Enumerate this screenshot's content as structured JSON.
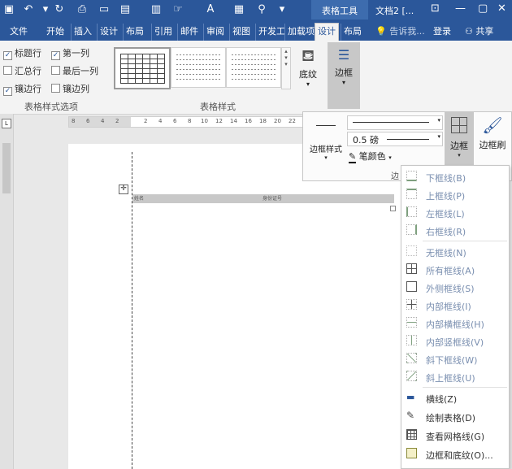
{
  "quick_access": {
    "icons": [
      "save-icon",
      "undo-icon",
      "redo-icon",
      "print-preview-icon",
      "new-doc-icon",
      "paste-icon",
      "format-icon",
      "touch-icon",
      "font-color-icon",
      "layout-icon",
      "search-icon",
      "more-icon"
    ]
  },
  "title": {
    "context": "表格工具",
    "doc": "文档2 [..."
  },
  "tabs": [
    "文件",
    "开始",
    "插入",
    "设计",
    "布局",
    "引用",
    "邮件",
    "审阅",
    "视图",
    "开发工",
    "加载项",
    "设计",
    "布局"
  ],
  "tell_me": "告诉我...",
  "login": "登录",
  "share": "共享",
  "ribbon": {
    "options": {
      "header_row": "标题行",
      "first_col": "第一列",
      "total_row": "汇总行",
      "last_col": "最后一列",
      "banded_rows": "镶边行",
      "banded_cols": "镶边列",
      "group": "表格样式选项"
    },
    "styles_group": "表格样式",
    "shading": "底纹",
    "borders": "边框"
  },
  "ruler": {
    "top": [
      "8",
      "6",
      "4",
      "2",
      "",
      "2",
      "4",
      "6",
      "8",
      "10",
      "12",
      "14",
      "16",
      "18",
      "20",
      "22"
    ]
  },
  "table_row": {
    "left": "姓名",
    "right": "身份证号"
  },
  "border_pane": {
    "style_label": "边框样式",
    "weight": "0.5 磅",
    "pen_color": "笔颜色",
    "borders_btn": "边框",
    "painter_btn": "边框刷",
    "group": "边"
  },
  "menu": [
    {
      "label": "下框线(B)",
      "icon": "border-bottom-icon",
      "dim": true
    },
    {
      "label": "上框线(P)",
      "icon": "border-top-icon",
      "dim": true
    },
    {
      "label": "左框线(L)",
      "icon": "border-left-icon",
      "dim": true
    },
    {
      "label": "右框线(R)",
      "icon": "border-right-icon",
      "dim": true
    },
    {
      "label": "无框线(N)",
      "icon": "border-none-icon",
      "dim": true
    },
    {
      "label": "所有框线(A)",
      "icon": "border-all-icon",
      "dim": true
    },
    {
      "label": "外侧框线(S)",
      "icon": "border-outside-icon",
      "dim": true
    },
    {
      "label": "内部框线(I)",
      "icon": "border-inside-icon",
      "dim": true
    },
    {
      "label": "内部横框线(H)",
      "icon": "border-inside-h-icon",
      "dim": true
    },
    {
      "label": "内部竖框线(V)",
      "icon": "border-inside-v-icon",
      "dim": true
    },
    {
      "label": "斜下框线(W)",
      "icon": "diag-down-icon",
      "dim": true
    },
    {
      "label": "斜上框线(U)",
      "icon": "diag-up-icon",
      "dim": true
    },
    {
      "label": "横线(Z)",
      "icon": "horizontal-line-icon",
      "dim": false
    },
    {
      "label": "绘制表格(D)",
      "icon": "draw-table-icon",
      "dim": false
    },
    {
      "label": "查看网格线(G)",
      "icon": "view-gridlines-icon",
      "dim": false
    },
    {
      "label": "边框和底纹(O)...",
      "icon": "borders-shading-icon",
      "dim": false
    }
  ]
}
